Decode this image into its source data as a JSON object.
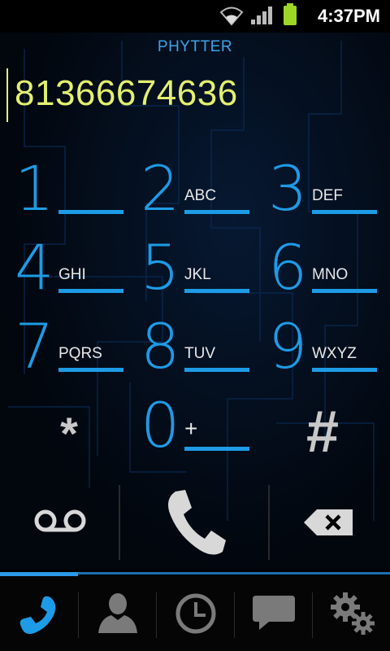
{
  "status": {
    "time": "4:37PM"
  },
  "app": {
    "title": "PHYTTER"
  },
  "dial": {
    "number": "81366674636"
  },
  "keypad": [
    {
      "digit": "1",
      "letters": ""
    },
    {
      "digit": "2",
      "letters": "ABC"
    },
    {
      "digit": "3",
      "letters": "DEF"
    },
    {
      "digit": "4",
      "letters": "GHI"
    },
    {
      "digit": "5",
      "letters": "JKL"
    },
    {
      "digit": "6",
      "letters": "MNO"
    },
    {
      "digit": "7",
      "letters": "PQRS"
    },
    {
      "digit": "8",
      "letters": "TUV"
    },
    {
      "digit": "9",
      "letters": "WXYZ"
    },
    {
      "digit": "*",
      "letters": ""
    },
    {
      "digit": "0",
      "letters": "+"
    },
    {
      "digit": "#",
      "letters": ""
    }
  ],
  "colors": {
    "accent": "#1e9be6",
    "number": "#e3f06e",
    "title": "#3aa3e8",
    "battery": "#9ed627"
  },
  "actions": [
    "voicemail-icon",
    "call-icon",
    "backspace-icon"
  ],
  "tabs": [
    "dialer-phone-icon",
    "contacts-person-icon",
    "history-clock-icon",
    "messages-chat-icon",
    "settings-gears-icon"
  ]
}
